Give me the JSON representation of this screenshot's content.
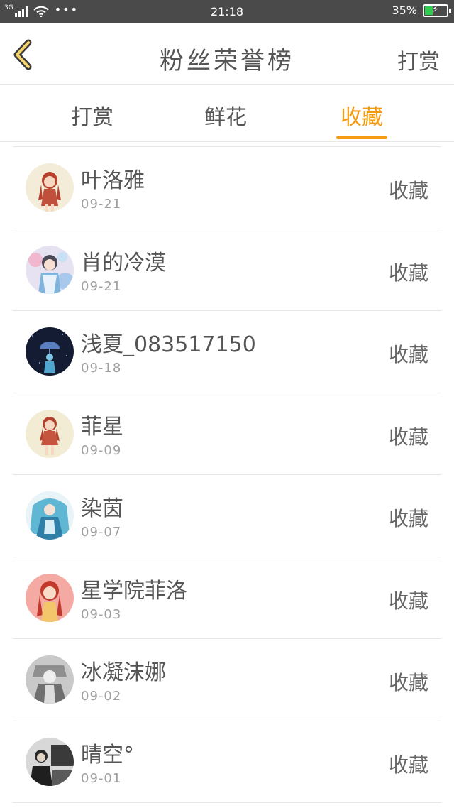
{
  "status_bar": {
    "network": "3G",
    "time": "21:18",
    "battery": "35%",
    "battery_level": 0.35,
    "battery_color": "#2fcc4f"
  },
  "header": {
    "title": "粉丝荣誉榜",
    "action": "打赏"
  },
  "tabs": [
    {
      "label": "打赏",
      "active": false
    },
    {
      "label": "鲜花",
      "active": false
    },
    {
      "label": "收藏",
      "active": true
    }
  ],
  "accent_color": "#f39c12",
  "list": [
    {
      "name": "叶洛雅",
      "date": "09-21",
      "type": "收藏"
    },
    {
      "name": "肖的冷漠",
      "date": "09-21",
      "type": "收藏"
    },
    {
      "name": "浅夏_083517150",
      "date": "09-18",
      "type": "收藏"
    },
    {
      "name": "菲星",
      "date": "09-09",
      "type": "收藏"
    },
    {
      "name": "染茵",
      "date": "09-07",
      "type": "收藏"
    },
    {
      "name": "星学院菲洛",
      "date": "09-03",
      "type": "收藏"
    },
    {
      "name": "冰凝沫娜",
      "date": "09-02",
      "type": "收藏"
    },
    {
      "name": "晴空°",
      "date": "09-01",
      "type": "收藏"
    }
  ]
}
